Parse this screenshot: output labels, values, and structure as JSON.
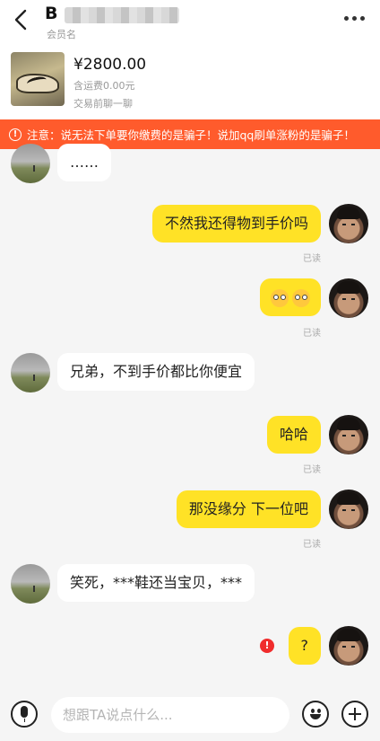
{
  "header": {
    "title": "B",
    "subtitle": "会员名"
  },
  "product": {
    "price": "¥2800.00",
    "shipping": "含运费0.00元",
    "chat_before_trade": "交易前聊一聊"
  },
  "warning": {
    "icon": "!",
    "text": "注意：说无法下单要你缴费的是骗子！说加qq刷单涨粉的是骗子！"
  },
  "messages": [
    {
      "side": "in",
      "text": "……"
    },
    {
      "side": "out",
      "text": "不然我还得物到手价吗",
      "status": "已读"
    },
    {
      "side": "out",
      "emoji": [
        "flushed-face",
        "flushed-face"
      ],
      "status": "已读"
    },
    {
      "side": "in",
      "text": "兄弟，不到手价都比你便宜"
    },
    {
      "side": "out",
      "text": "哈哈",
      "status": "已读"
    },
    {
      "side": "out",
      "text": "那没缘分 下一位吧",
      "status": "已读"
    },
    {
      "side": "in",
      "text": "笑死，***鞋还当宝贝，***"
    },
    {
      "side": "out",
      "text": "?",
      "failed": "!"
    }
  ],
  "input_bar": {
    "placeholder": "想跟TA说点什么..."
  },
  "colors": {
    "warning_bg": "#ff5b2c",
    "outgoing_bubble": "#ffe226",
    "incoming_bubble": "#ffffff",
    "error": "#f02c2c"
  }
}
